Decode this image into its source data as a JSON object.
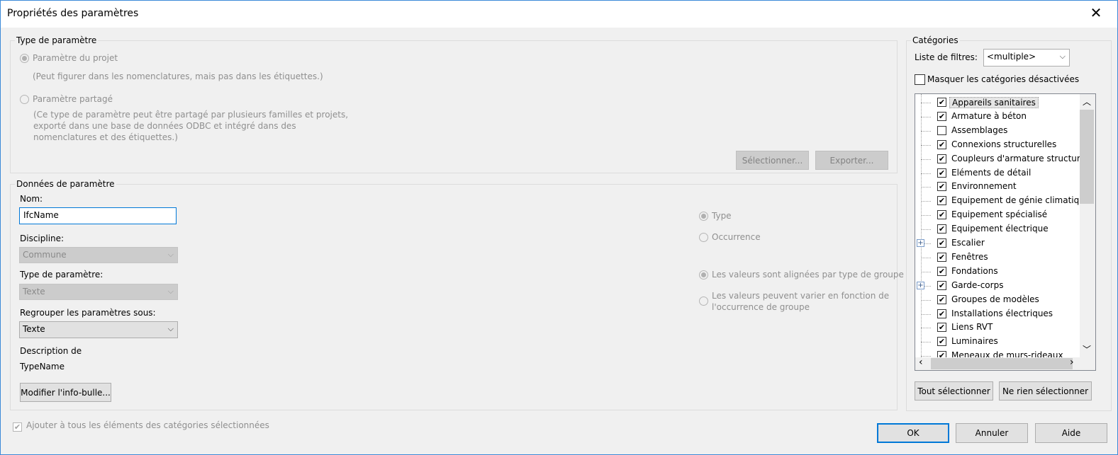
{
  "window": {
    "title": "Propriétés des paramètres"
  },
  "param_type": {
    "legend": "Type de paramètre",
    "project": {
      "label": "Paramètre du projet",
      "desc": "(Peut figurer dans les nomenclatures, mais pas dans les étiquettes.)"
    },
    "shared": {
      "label": "Paramètre partagé",
      "desc_lines": [
        "(Ce type de paramètre peut être partagé par plusieurs familles et projets,",
        "exporté dans une base de données ODBC et intégré dans des",
        "nomenclatures et des étiquettes.)"
      ]
    },
    "select_btn": "Sélectionner...",
    "export_btn": "Exporter..."
  },
  "param_data": {
    "legend": "Données de paramètre",
    "name_label": "Nom:",
    "name_value": "IfcName",
    "discipline_label": "Discipline:",
    "discipline_value": "Commune",
    "type_label": "Type de paramètre:",
    "type_value": "Texte",
    "group_label": "Regrouper les paramètres sous:",
    "group_value": "Texte",
    "description_label": "Description de",
    "description_value": "TypeName",
    "tooltip_btn": "Modifier l'info-bulle...",
    "radio_type": "Type",
    "radio_occurrence": "Occurrence",
    "radio_aligned": "Les valeurs sont alignées par type de groupe",
    "radio_vary_lines": [
      "Les valeurs peuvent varier en fonction de",
      "l'occurrence de groupe"
    ]
  },
  "add_all_label": "Ajouter à tous les éléments des catégories sélectionnées",
  "categories": {
    "legend": "Catégories",
    "filter_label": "Liste de filtres:",
    "filter_value": "<multiple>",
    "hide_label": "Masquer les catégories désactivées",
    "items": [
      {
        "label": "Appareils sanitaires",
        "checked": true,
        "expander": false
      },
      {
        "label": "Armature à béton",
        "checked": true,
        "expander": false
      },
      {
        "label": "Assemblages",
        "checked": false,
        "expander": false
      },
      {
        "label": "Connexions structurelles",
        "checked": true,
        "expander": false
      },
      {
        "label": "Coupleurs d'armature structur...",
        "checked": true,
        "expander": false
      },
      {
        "label": "Eléments de détail",
        "checked": true,
        "expander": false
      },
      {
        "label": "Environnement",
        "checked": true,
        "expander": false
      },
      {
        "label": "Equipement de génie climatiq...",
        "checked": true,
        "expander": false
      },
      {
        "label": "Equipement spécialisé",
        "checked": true,
        "expander": false
      },
      {
        "label": "Equipement électrique",
        "checked": true,
        "expander": false
      },
      {
        "label": "Escalier",
        "checked": true,
        "expander": true
      },
      {
        "label": "Fenêtres",
        "checked": true,
        "expander": false
      },
      {
        "label": "Fondations",
        "checked": true,
        "expander": false
      },
      {
        "label": "Garde-corps",
        "checked": true,
        "expander": true
      },
      {
        "label": "Groupes de modèles",
        "checked": true,
        "expander": false
      },
      {
        "label": "Installations électriques",
        "checked": true,
        "expander": false
      },
      {
        "label": "Liens RVT",
        "checked": true,
        "expander": false
      },
      {
        "label": "Luminaires",
        "checked": true,
        "expander": false
      },
      {
        "label": "Meneaux de murs-rideaux",
        "checked": true,
        "expander": false
      }
    ],
    "select_all_btn": "Tout sélectionner",
    "select_none_btn": "Ne rien sélectionner"
  },
  "buttons": {
    "ok": "OK",
    "cancel": "Annuler",
    "help": "Aide"
  },
  "glyphs": {
    "check": "✔",
    "chevron_down": "⌵",
    "scroll_up": "︿",
    "scroll_down": "﹀",
    "scroll_left": "‹",
    "scroll_right": "›",
    "plus": "+",
    "close": "✕"
  }
}
